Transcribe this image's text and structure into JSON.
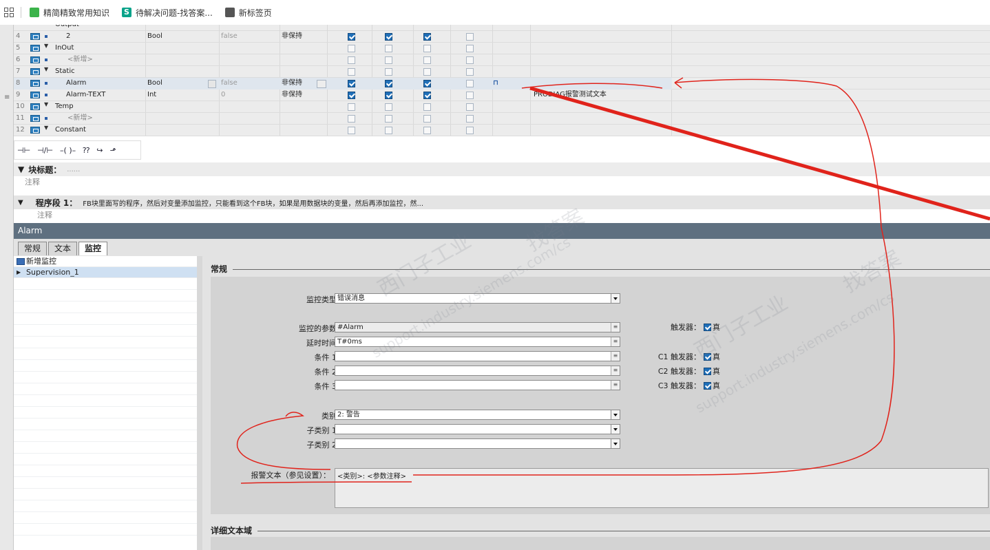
{
  "bookmarks": [
    {
      "label": "精简精致常用知识",
      "icon": "leaf-icon"
    },
    {
      "label": "待解决问题-找答案...",
      "icon": "s-icon"
    },
    {
      "label": "新标签页",
      "icon": "globe-icon"
    }
  ],
  "table": {
    "rows": [
      {
        "num": "4",
        "name": "2",
        "type": "Bool",
        "default": "false",
        "retain": "非保持",
        "checks": [
          true,
          true,
          true,
          false
        ]
      },
      {
        "num": "5",
        "name": "InOut",
        "type": "",
        "default": "",
        "retain": "",
        "checks": [
          false,
          false,
          false,
          false
        ]
      },
      {
        "num": "6",
        "name": "<新增>",
        "type": "",
        "default": "",
        "retain": "",
        "checks": [
          false,
          false,
          false,
          false
        ]
      },
      {
        "num": "7",
        "name": "Static",
        "type": "",
        "default": "",
        "retain": "",
        "checks": [
          false,
          false,
          false,
          false
        ]
      },
      {
        "num": "8",
        "name": "Alarm",
        "type": "Bool",
        "default": "false",
        "retain": "非保持",
        "checks": [
          true,
          true,
          true,
          false
        ]
      },
      {
        "num": "9",
        "name": "Alarm-TEXT",
        "type": "Int",
        "default": "0",
        "retain": "非保持",
        "checks": [
          true,
          true,
          true,
          false
        ],
        "comment": "PRODIAG报警测试文本"
      },
      {
        "num": "10",
        "name": "Temp",
        "type": "",
        "default": "",
        "retain": "",
        "checks": [
          false,
          false,
          false,
          false
        ]
      },
      {
        "num": "11",
        "name": "<新增>",
        "type": "",
        "default": "",
        "retain": "",
        "checks": [
          false,
          false,
          false,
          false
        ]
      },
      {
        "num": "12",
        "name": "Constant",
        "type": "",
        "default": "",
        "retain": "",
        "checks": [
          false,
          false,
          false,
          false
        ]
      }
    ],
    "partial_top_row": "Output"
  },
  "toolbar": {
    "icons": [
      "contact-no-icon",
      "contact-nc-icon",
      "coil-icon",
      "box-icon",
      "branch-open-icon",
      "branch-close-icon"
    ],
    "glyphs": [
      "⊣⊢",
      "⊣/⊢",
      "–( )–",
      "⁇",
      "↪",
      "⬏"
    ]
  },
  "block": {
    "title_label": "块标题：",
    "title_value": "......",
    "comment": "注释",
    "segment_label": "程序段 1：",
    "segment_text": "FB块里面写的程序，然后对变量添加监控，只能看到这个FB块，如果是用数据块的变量，然后再添加监控，然...",
    "segment_comment": "注释"
  },
  "inspector": {
    "title": "Alarm",
    "tabs": [
      "常规",
      "文本",
      "监控"
    ],
    "active_tab": "监控",
    "tree": [
      {
        "label": "新增监控"
      },
      {
        "label": "Supervision_1"
      }
    ],
    "section_general": "常规",
    "section_detail": "详细文本域",
    "fields": {
      "sup_type_label": "监控类型：",
      "sup_type_value": "错误消息",
      "param_label": "监控的参数：",
      "param_value": "#Alarm",
      "delay_label": "延时时间：",
      "delay_value": "T#0ms",
      "cond1_label": "条件 1：",
      "cond2_label": "条件 2：",
      "cond3_label": "条件 3：",
      "category_label": "类别：",
      "category_value": "2: 警告",
      "subcat1_label": "子类别 1：",
      "subcat2_label": "子类别 2：",
      "alarm_text_label": "报警文本（参见设置）：",
      "alarm_text_value": "<类别>: <参数注释>"
    },
    "triggers": [
      {
        "label": "触发器：",
        "value": "真"
      },
      {
        "label": "C1 触发器：",
        "value": "真"
      },
      {
        "label": "C2 触发器：",
        "value": "真"
      },
      {
        "label": "C3 触发器：",
        "value": "真"
      }
    ]
  },
  "watermark": [
    "西门子工业",
    "support.industry.siemens.com/cs",
    "找答案"
  ]
}
